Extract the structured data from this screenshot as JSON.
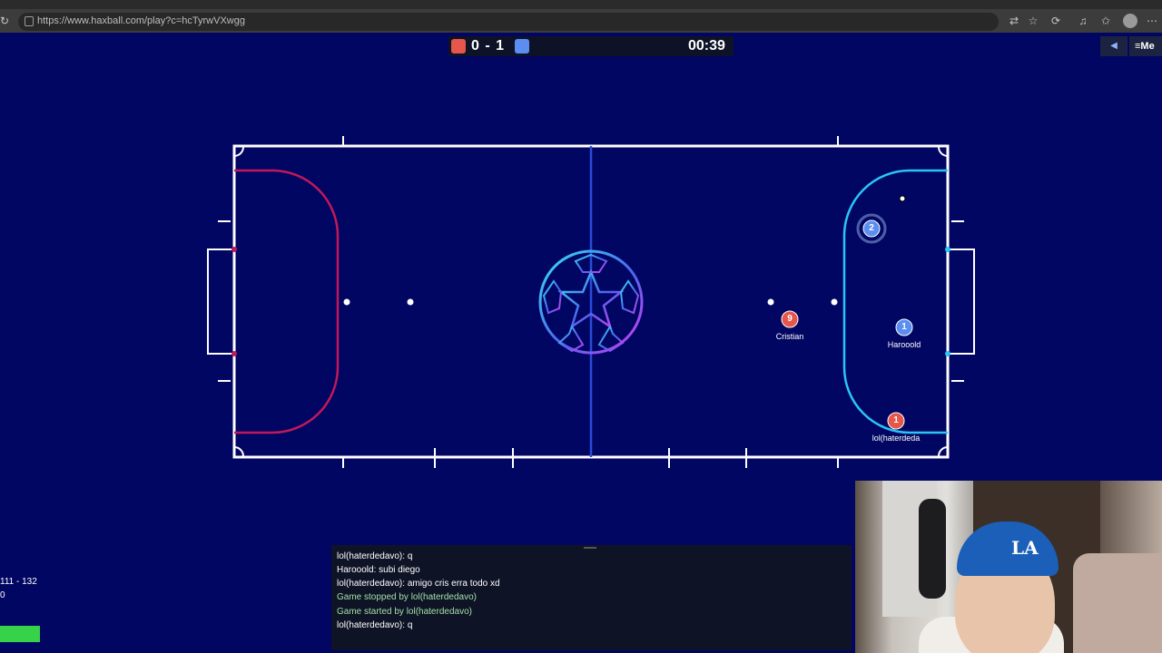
{
  "browser": {
    "url": "https://www.haxball.com/play?c=hcTyrwVXwgg"
  },
  "scoreboard": {
    "score": "0 - 1",
    "timer": "00:39",
    "red_color": "#e5564b",
    "blue_color": "#5b8ef0"
  },
  "topright": {
    "sound_icon": "speaker-icon",
    "menu_label": "≡Me"
  },
  "players": [
    {
      "number": "2",
      "team": "blue",
      "name": ""
    },
    {
      "number": "9",
      "team": "red",
      "name": "Cristian"
    },
    {
      "number": "1",
      "team": "blue",
      "name": "Harooold"
    },
    {
      "number": "1",
      "team": "red",
      "name": "lol(haterdeda"
    }
  ],
  "chat": {
    "messages": [
      {
        "text": "lol(haterdedavo): q",
        "system": false
      },
      {
        "text": "Harooold: subi diego",
        "system": false
      },
      {
        "text": "lol(haterdedavo): amigo cris erra todo xd",
        "system": false
      },
      {
        "text": "Game stopped by lol(haterdedavo)",
        "system": true
      },
      {
        "text": "Game started by lol(haterdedavo)",
        "system": true
      },
      {
        "text": "lol(haterdedavo): q",
        "system": false
      }
    ]
  },
  "stats": {
    "line1": "111 - 132",
    "line2": "0"
  },
  "colors": {
    "field_bg": "#010663",
    "field_lines": "#ffffff",
    "red_area": "#c2185b",
    "blue_area": "#29c5f6",
    "midline": "#2a4bd7"
  }
}
